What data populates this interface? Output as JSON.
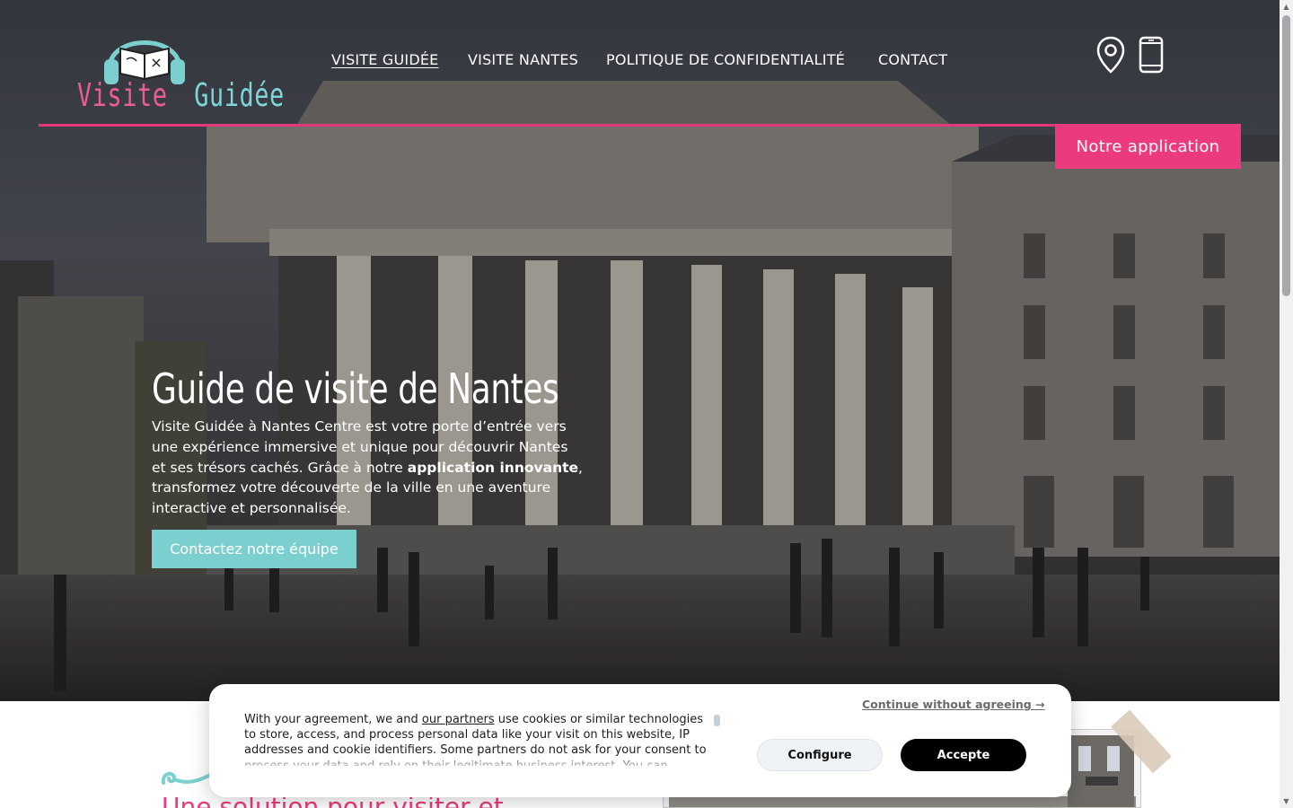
{
  "header": {
    "logo_words": [
      "Visite",
      "Guidée"
    ],
    "nav": [
      {
        "label": "VISITE GUIDÉE",
        "active": true
      },
      {
        "label": "VISITE NANTES",
        "active": false
      },
      {
        "label": "POLITIQUE DE CONFIDENTIALITÉ",
        "active": false
      },
      {
        "label": "CONTACT",
        "active": false
      }
    ],
    "icons": [
      "location-pin-icon",
      "smartphone-icon"
    ],
    "app_button": "Notre application",
    "accent_color": "#ec3a7e",
    "secondary_color": "#7ccfcf"
  },
  "hero": {
    "title": "Guide de visite de Nantes",
    "description_before": "Visite Guidée à Nantes Centre est votre porte d’entrée vers une expérience immersive et unique pour découvrir Nantes et ses trésors cachés. Grâce à notre ",
    "description_bold": "application innovante",
    "description_after": ", transformez votre découverte de la ville en une aventure interactive et personnalisée.",
    "cta": "Contactez notre équipe"
  },
  "below": {
    "heading_partial": "Une solution pour visiter et"
  },
  "cookie_banner": {
    "text_before_link": "With your agreement, we and ",
    "link": "our partners",
    "text_after_link": " use cookies or similar technologies to store, access, and process personal data like your visit on this website, IP addresses and cookie identifiers. Some partners do not ask for your consent to process your data and rely on their legitimate business interest. You can",
    "continue": "Continue without agreeing →",
    "configure": "Configure",
    "accept": "Accepte"
  }
}
